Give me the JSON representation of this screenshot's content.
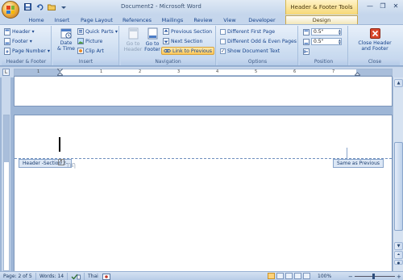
{
  "titlebar": {
    "document_title": "Document2 - Microsoft Word",
    "context_title": "Header & Footer Tools",
    "minimize": "—",
    "maximize": "❐",
    "close": "✕"
  },
  "tabs": [
    "Home",
    "Insert",
    "Page Layout",
    "References",
    "Mailings",
    "Review",
    "View",
    "Developer",
    "Design"
  ],
  "ribbon": {
    "header_footer": {
      "header": "Header",
      "footer": "Footer",
      "page_number": "Page Number",
      "label": "Header & Footer"
    },
    "insert": {
      "date_time_line1": "Date",
      "date_time_line2": "& Time",
      "quick_parts": "Quick Parts",
      "picture": "Picture",
      "clip_art": "Clip Art",
      "label": "Insert"
    },
    "navigation": {
      "go_to_header_line1": "Go to",
      "go_to_header_line2": "Header",
      "go_to_footer_line1": "Go to",
      "go_to_footer_line2": "Footer",
      "previous_section": "Previous Section",
      "next_section": "Next Section",
      "link_to_previous": "Link to Previous",
      "label": "Navigation"
    },
    "options": {
      "different_first_page": "Different First Page",
      "different_odd_even": "Different Odd & Even Pages",
      "show_document_text": "Show Document Text",
      "different_first_page_checked": false,
      "different_odd_even_checked": false,
      "show_document_text_checked": true,
      "label": "Options"
    },
    "position": {
      "header_from_top": "0.5\"",
      "footer_from_bottom": "0.5\"",
      "label": "Position"
    },
    "close": {
      "line1": "Close Header",
      "line2": "and Footer",
      "label": "Close"
    }
  },
  "ruler": {
    "corner_symbol": "L",
    "numbers": [
      "1",
      "1",
      "2",
      "3",
      "4",
      "5",
      "6",
      "7"
    ]
  },
  "document": {
    "header_tag": "Header -Section 2-",
    "same_as_previous": "Same as Previous",
    "header_text": "กฤ"
  },
  "statusbar": {
    "page": "Page: 2 of 5",
    "words": "Words: 14",
    "language": "Thai",
    "zoom": "100%",
    "zoom_minus": "−",
    "zoom_plus": "+"
  },
  "colors": {
    "accent": "#15428b",
    "context_tab": "#f6d877",
    "highlight": "#ffc85a"
  }
}
